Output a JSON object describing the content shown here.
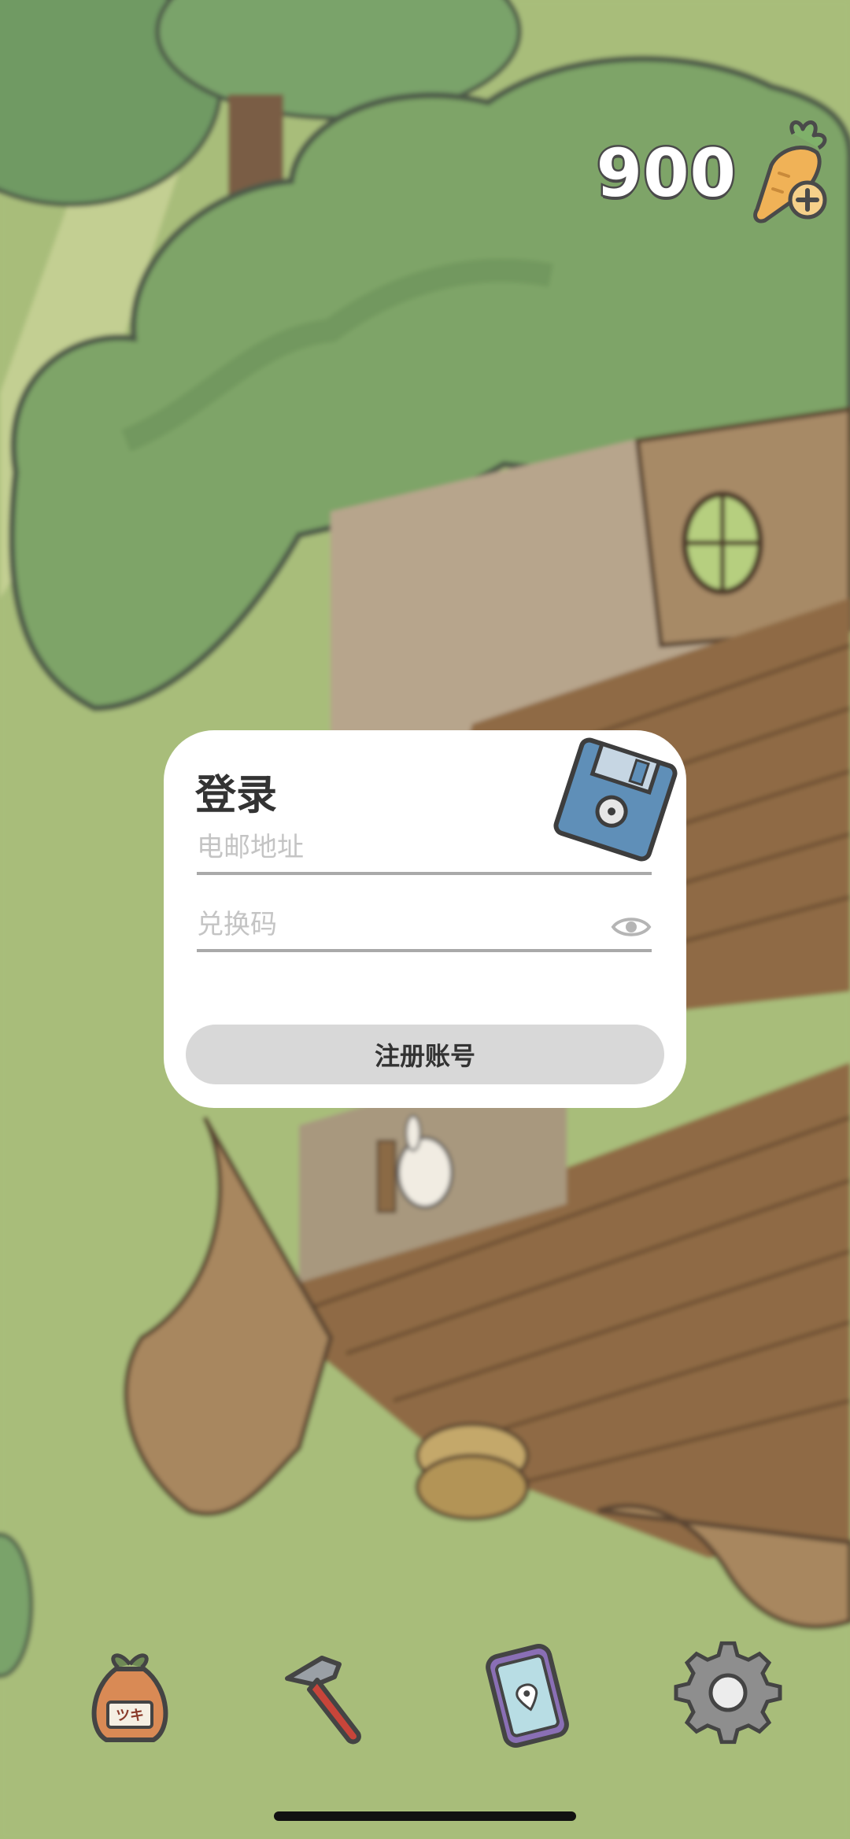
{
  "hud": {
    "carrot_count": "900",
    "carrot_icon": "carrot-plus-icon"
  },
  "login_dialog": {
    "title": "登录",
    "icon": "floppy-disk-icon",
    "email_placeholder": "电邮地址",
    "code_placeholder": "兑换码",
    "visibility_icon": "eye-icon",
    "register_label": "注册账号"
  },
  "toolbar": {
    "items": [
      {
        "icon": "bag-icon",
        "label": "ツキ"
      },
      {
        "icon": "hammer-icon"
      },
      {
        "icon": "phone-map-icon"
      },
      {
        "icon": "settings-gear-icon"
      }
    ]
  },
  "colors": {
    "grass": "#a8bd7a",
    "foliage": "#7a9e64",
    "wood": "#8a6a48",
    "dialog_bg": "#ffffff",
    "button_bg": "#d8d8d8"
  }
}
